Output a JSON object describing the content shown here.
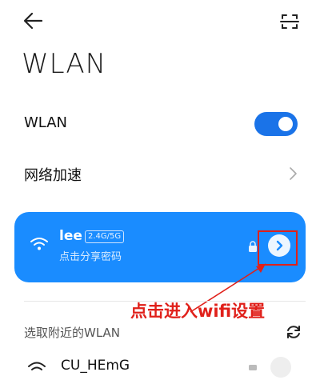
{
  "header": {
    "back_icon": "arrow-left-icon",
    "scan_icon": "scan-qr-icon",
    "title": "WLAN"
  },
  "wlan_toggle": {
    "label": "WLAN",
    "enabled": true
  },
  "network_acceleration": {
    "label": "网络加速"
  },
  "connected_network": {
    "ssid": "lee",
    "band": "2.4G/5G",
    "subtitle": "点击分享密码",
    "secured": true,
    "card_color": "#1a8cff"
  },
  "annotation": {
    "text": "点击进入wifi设置",
    "color": "#e0201a"
  },
  "nearby": {
    "header": "选取附近的WLAN",
    "networks": [
      {
        "name": "CU_HEmG",
        "secured": true
      }
    ]
  },
  "colors": {
    "accent": "#1a73e8"
  }
}
